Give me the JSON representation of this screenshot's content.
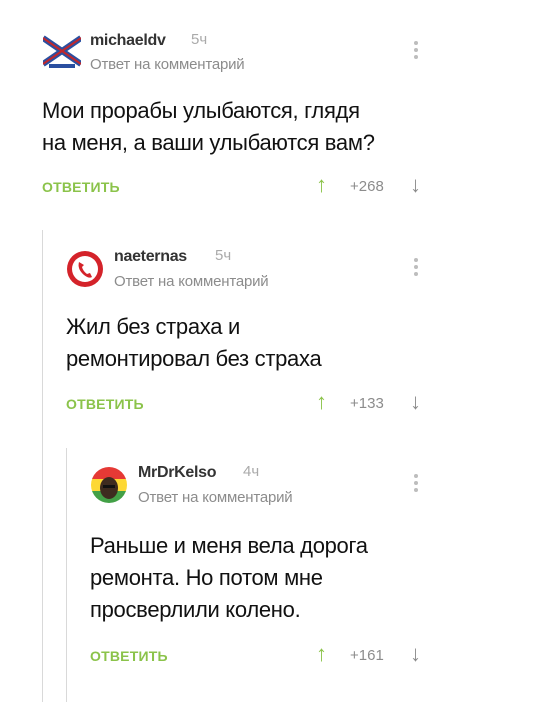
{
  "comments": [
    {
      "username": "michaeldv",
      "time": "5ч",
      "reply_prefix": "Ответ на",
      "reply_link": "комментарий",
      "text_lines": [
        "Мои прорабы улыбаются, глядя",
        "на меня, а ваши улыбаются вам?"
      ],
      "reply_label": "ОТВЕТИТЬ",
      "score": "+268"
    },
    {
      "username": "naeternas",
      "time": "5ч",
      "reply_prefix": "Ответ на",
      "reply_link": "комментарий",
      "text_lines": [
        "Жил без страха и",
        "ремонтировал без страха"
      ],
      "reply_label": "ОТВЕТИТЬ",
      "score": "+133"
    },
    {
      "username": "MrDrKelso",
      "time": "4ч",
      "reply_prefix": "Ответ на",
      "reply_link": "комментарий",
      "text_lines": [
        "Раньше и меня вела дорога",
        "ремонта. Но потом мне",
        "просверлили колено."
      ],
      "reply_label": "ОТВЕТИТЬ",
      "score": "+161"
    }
  ],
  "icons": {
    "up": "up-arrow-icon",
    "down": "down-arrow-icon",
    "menu": "more-vertical-icon"
  },
  "colors": {
    "accent": "#8bc34a",
    "muted": "#8c8c8c"
  }
}
